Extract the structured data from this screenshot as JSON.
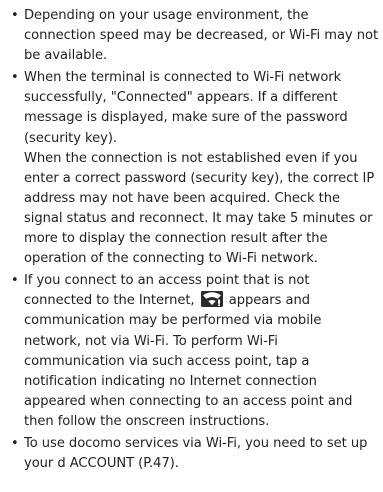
{
  "bullet_char": "•",
  "items": [
    {
      "paragraphs": [
        "Depending on your usage environment, the connection speed may be decreased, or Wi-Fi may not be available."
      ]
    },
    {
      "paragraphs": [
        "When the terminal is connected to Wi-Fi network successfully, \"Connected\" appears. If a different message is displayed, make sure of the password (security key).",
        "When the connection is not established even if you enter a correct password (security key), the correct IP address may not have been acquired. Check the signal status and reconnect. It may take 5 minutes or more to display the connection result after the operation of the connecting to Wi-Fi network."
      ]
    },
    {
      "before_icon": "If you connect to an access point that is not connected to the Internet,",
      "icon": "wifi-no-internet-icon",
      "after_icon": "appears and communication may be performed via mobile network, not via Wi-Fi. To perform Wi-Fi communication via such access point, tap a notification indicating no Internet connection appeared when connecting to an access point and then follow the onscreen instructions."
    },
    {
      "paragraphs": [
        "To use docomo services via Wi-Fi, you need to set up your d ACCOUNT (P.47)."
      ]
    }
  ]
}
